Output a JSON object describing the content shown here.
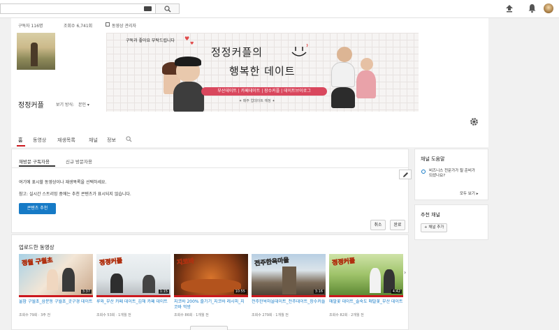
{
  "topbar": {
    "search_placeholder": ""
  },
  "channel": {
    "stats": {
      "subscribers": "구독자 116명",
      "views": "조회수 6,741회",
      "manager": "동영상 관리자"
    },
    "banner": {
      "tagline": "구독과 좋아요 부탁드립니다",
      "title_line1": "정정커플의",
      "title_line2": "행복한 데이트",
      "pill": "부산데이트 | 카페데이트 | 장수커플 | 데이트브이로그",
      "sub": "✦ 매주 업데이트 예정 ✦"
    },
    "name": "정정커플",
    "view_as_label": "보기 방식:",
    "view_as_value": "본인"
  },
  "tabs": [
    "홈",
    "동영상",
    "재생목록",
    "채널",
    "정보"
  ],
  "panel": {
    "subtabs": [
      "재방문 구독자용",
      "신규 방문자용"
    ],
    "notice1": "여기에 표시할 동영상이나 재생목록을 선택하세요.",
    "notice2": "참고: 실시간 스트리밍 중에는 추천 콘텐츠가 표시되지 않습니다.",
    "add_content": "콘텐츠 추천",
    "cancel": "취소",
    "done": "완료"
  },
  "uploads": {
    "title": "업로드한 동영상",
    "videos": [
      {
        "title": "울맘 구월초_삼문동 구월초_곳구경 데이트",
        "meta": "조회수 79회 · 3주 전",
        "duration": "3:37",
        "thumb_text": "정월 구월초"
      },
      {
        "title": "루와_부산 카페 데이트_김해 카페 데이트",
        "meta": "조회수 53회 · 1개월 전",
        "duration": "1:15",
        "thumb_text": "정정커플"
      },
      {
        "title": "지코바 200% 즐기기_지코바 레시피_지코바 먹방",
        "meta": "조회수 86회 · 1개월 전",
        "duration": "10:55",
        "thumb_text": "지코바"
      },
      {
        "title": "전주한옥마을데이트_전주데이트_장수커플",
        "meta": "조회수 279회 · 1개월 전",
        "duration": "3:16",
        "thumb_text": "전주한옥마을"
      },
      {
        "title": "매말꽃 데이트_솔숙도 매말꽃_부산 데이트",
        "meta": "조회수 82회 · 2개월 전",
        "duration": "4:42",
        "thumb_text": "정정커플"
      }
    ]
  },
  "sidebar": {
    "help_title": "채널 도움말",
    "help_text": "비즈니스 전문가가 될 준비가 되셨나요?",
    "see_all": "모두 보기 ▸",
    "rec_title": "추천 채널",
    "add_channel": "+ 채널 추가"
  }
}
